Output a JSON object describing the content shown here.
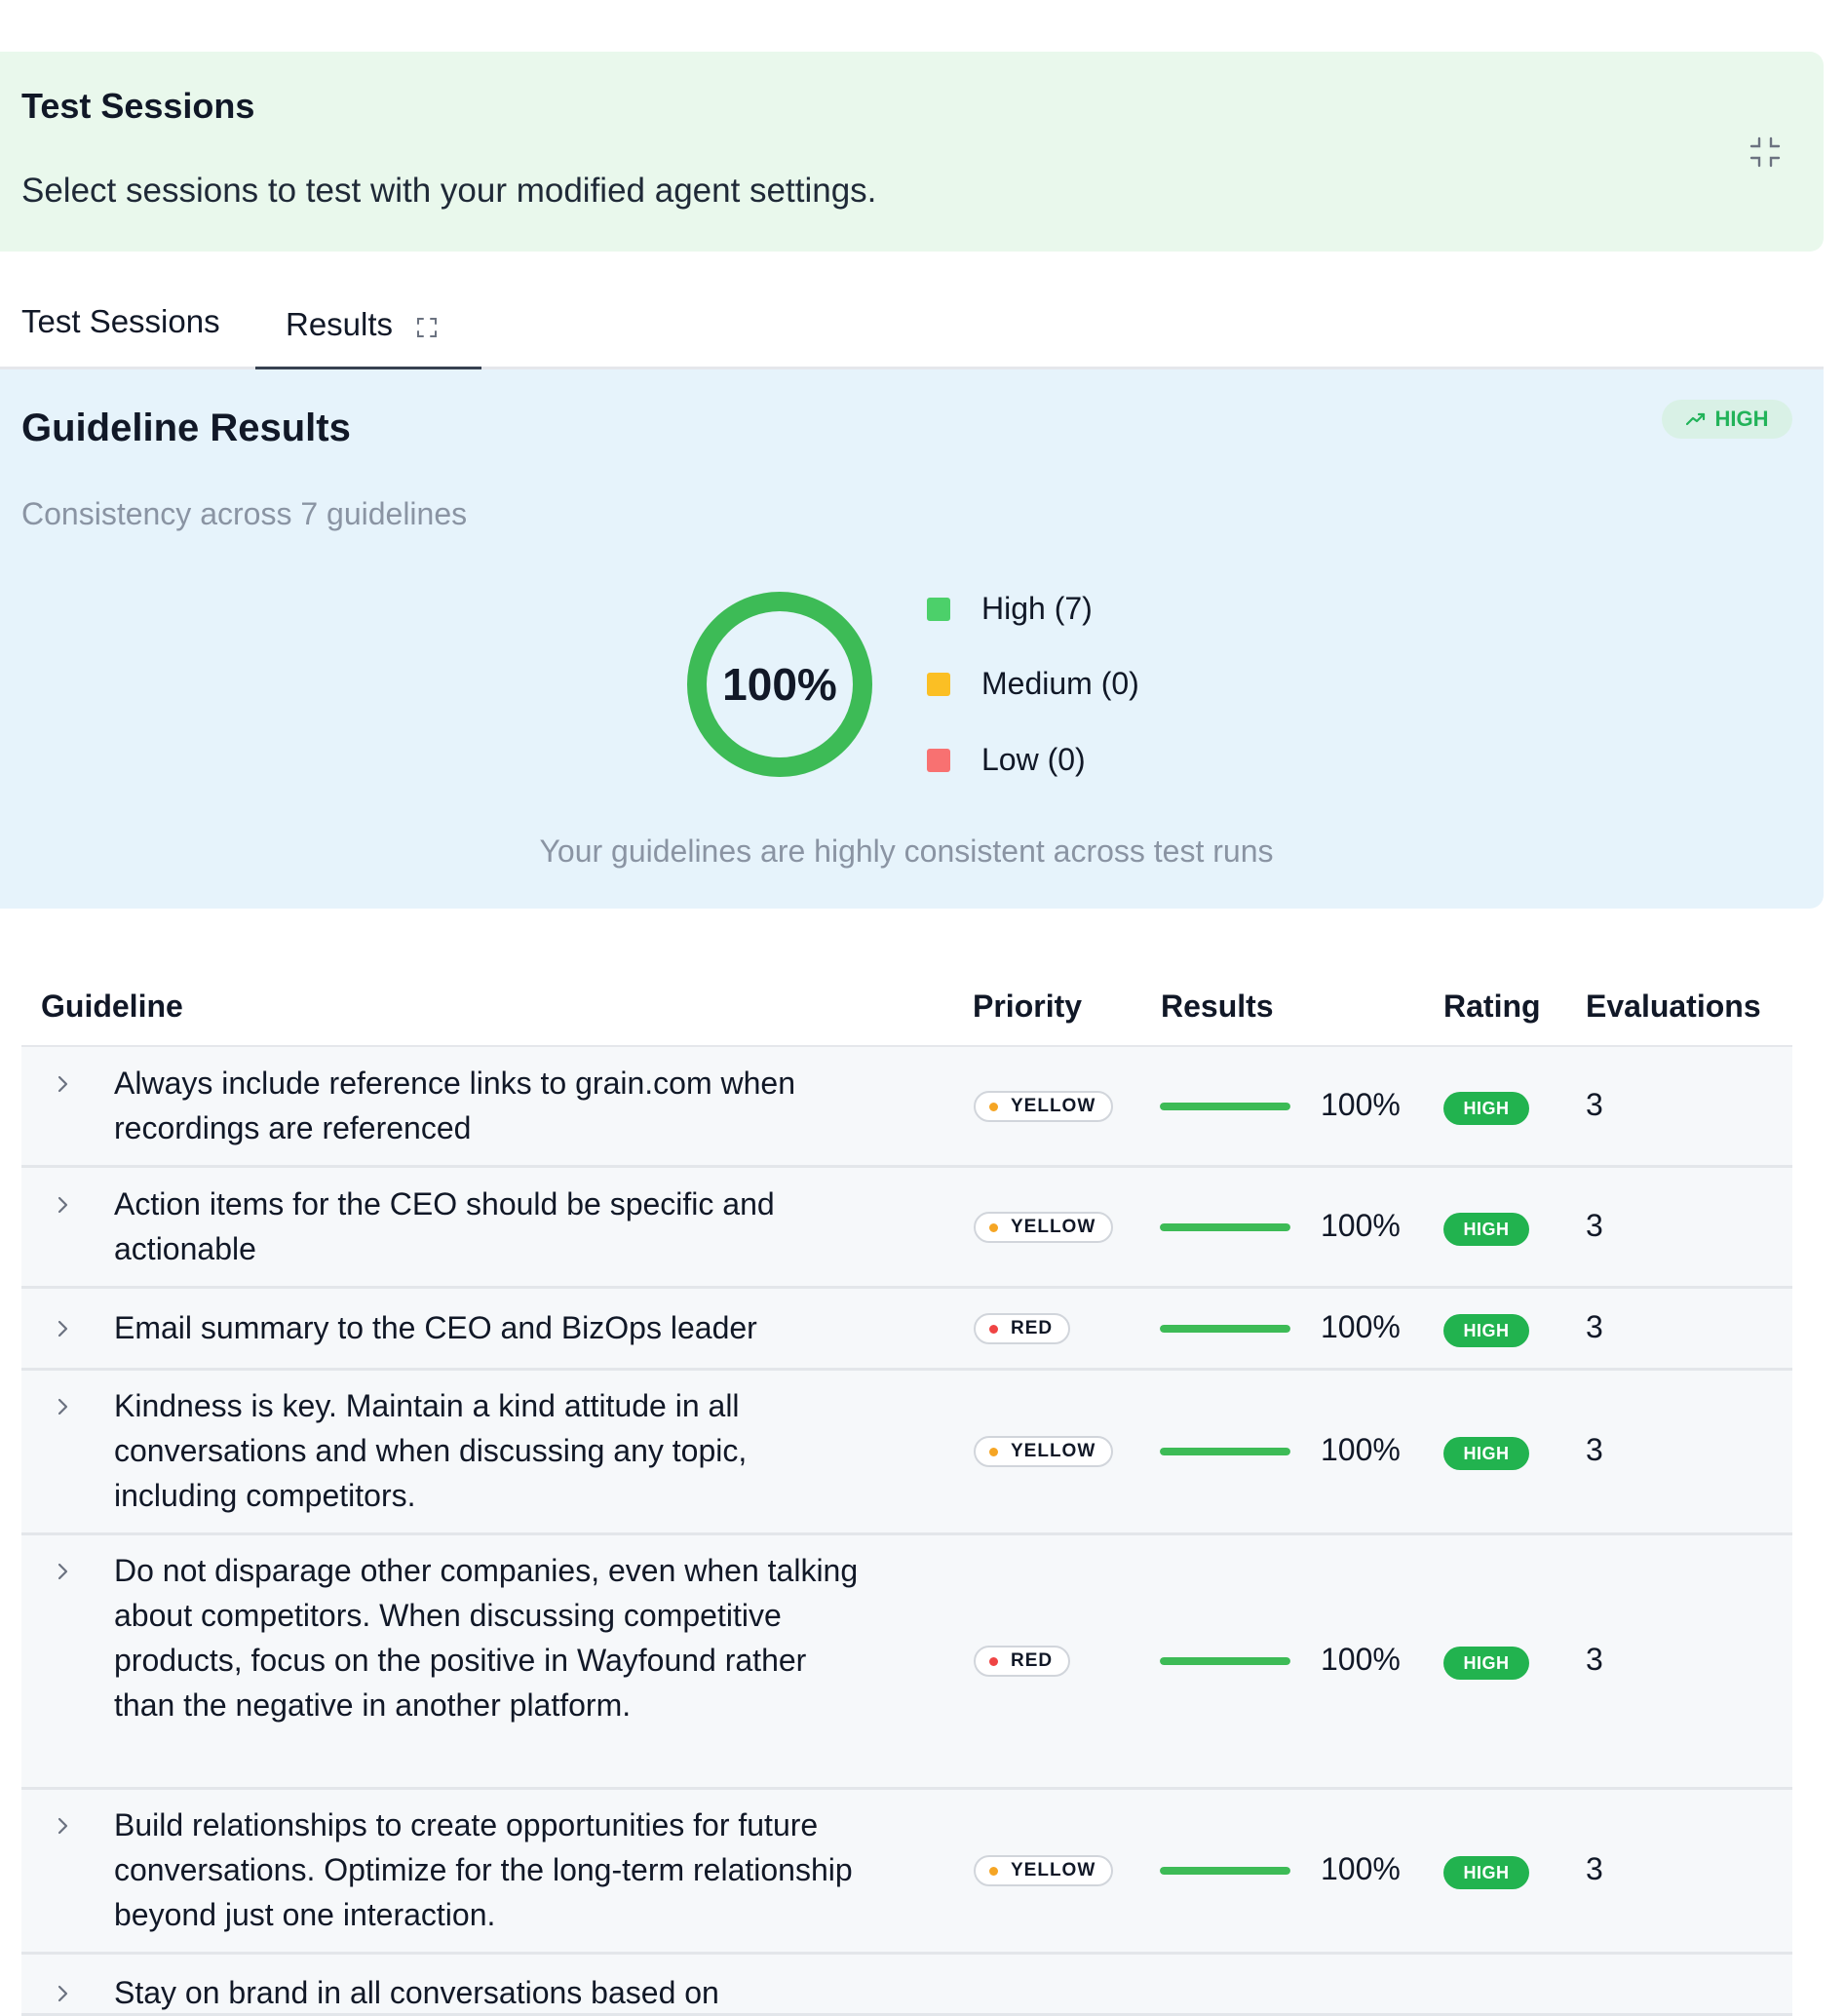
{
  "sessions_panel": {
    "title": "Test Sessions",
    "description": "Select sessions to test with your modified agent settings."
  },
  "tabs": [
    {
      "label": "Test Sessions",
      "active": false
    },
    {
      "label": "Results",
      "active": true
    }
  ],
  "results_panel": {
    "title": "Guideline Results",
    "subtitle": "Consistency across 7 guidelines",
    "level_badge": "HIGH",
    "score_label": "100%",
    "score": 1.0,
    "legend": [
      {
        "label": "High (7)",
        "color": "#4cd06a"
      },
      {
        "label": "Medium (0)",
        "color": "#fbbf24"
      },
      {
        "label": "Low (0)",
        "color": "#f87171"
      }
    ],
    "footer": "Your guidelines are highly consistent across test runs"
  },
  "table": {
    "headers": {
      "guideline": "Guideline",
      "priority": "Priority",
      "results": "Results",
      "rating": "Rating",
      "evaluations": "Evaluations"
    },
    "rows": [
      {
        "guideline": "Always include reference links to grain.com when recordings are referenced",
        "priority": "YELLOW",
        "priority_color": "#f5a524",
        "result": 1.0,
        "result_label": "100%",
        "rating": "HIGH",
        "evaluations": "3"
      },
      {
        "guideline": "Action items for the CEO should be specific and actionable",
        "priority": "YELLOW",
        "priority_color": "#f5a524",
        "result": 1.0,
        "result_label": "100%",
        "rating": "HIGH",
        "evaluations": "3"
      },
      {
        "guideline": "Email summary to the CEO and BizOps leader",
        "priority": "RED",
        "priority_color": "#ef4444",
        "result": 1.0,
        "result_label": "100%",
        "rating": "HIGH",
        "evaluations": "3"
      },
      {
        "guideline": "Kindness is key. Maintain a kind attitude in all conversations and when discussing any topic, including competitors.",
        "priority": "YELLOW",
        "priority_color": "#f5a524",
        "result": 1.0,
        "result_label": "100%",
        "rating": "HIGH",
        "evaluations": "3"
      },
      {
        "guideline": "Do not disparage other companies, even when talking about competitors. When discussing competitive products, focus on the positive in Wayfound rather than the negative in another platform.",
        "priority": "RED",
        "priority_color": "#ef4444",
        "result": 1.0,
        "result_label": "100%",
        "rating": "HIGH",
        "evaluations": "3"
      },
      {
        "guideline": "Build relationships to create opportunities for future conversations. Optimize for the long-term relationship beyond just one interaction.",
        "priority": "YELLOW",
        "priority_color": "#f5a524",
        "result": 1.0,
        "result_label": "100%",
        "rating": "HIGH",
        "evaluations": "3"
      },
      {
        "guideline": "Stay on brand in all conversations based on",
        "priority": "",
        "priority_color": "",
        "result": null,
        "result_label": "",
        "rating": "",
        "evaluations": ""
      }
    ]
  }
}
